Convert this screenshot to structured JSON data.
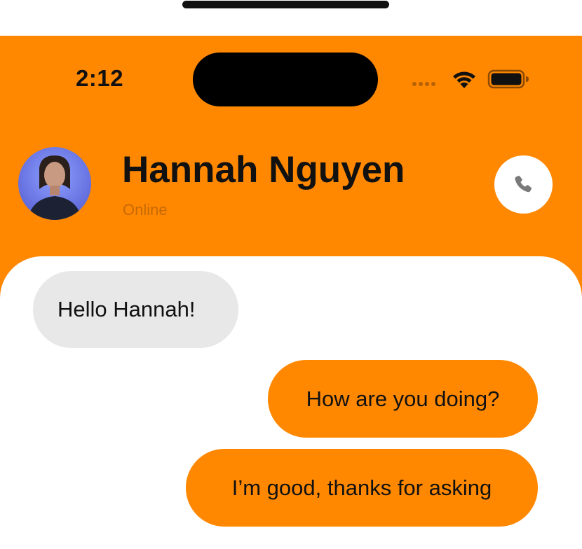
{
  "status_bar": {
    "time": "2:12",
    "wifi_icon": "wifi-icon",
    "battery_icon": "battery-icon",
    "signal_icon": "cellular-signal-icon"
  },
  "theme": {
    "accent": "#FF8800",
    "incoming_bubble": "#E8E8E8",
    "text": "#111111"
  },
  "header": {
    "contact_name": "Hannah Nguyen",
    "status": "Online",
    "call_icon": "phone-icon",
    "avatar": "avatar-photo"
  },
  "messages": [
    {
      "direction": "incoming",
      "text": "Hello Hannah!"
    },
    {
      "direction": "outgoing",
      "text": "How are you doing?"
    },
    {
      "direction": "outgoing",
      "text": "I’m good, thanks for asking"
    }
  ]
}
